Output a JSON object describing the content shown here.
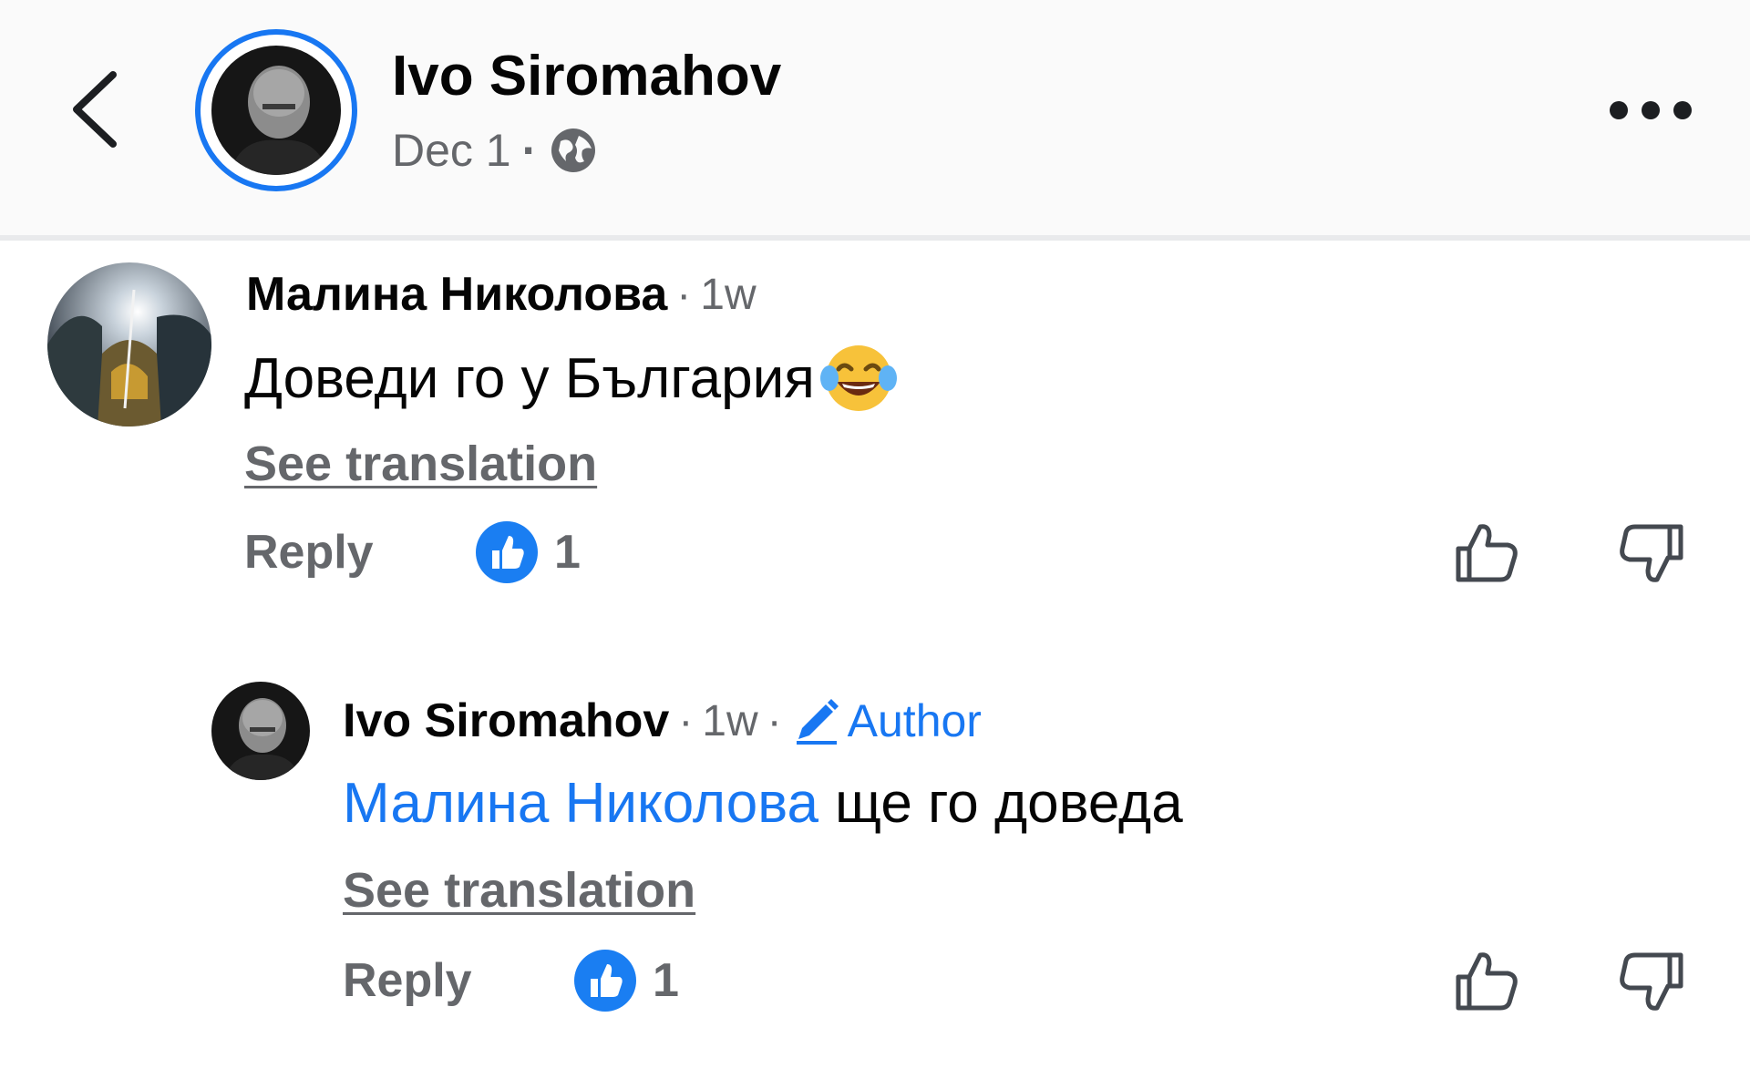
{
  "header": {
    "name": "Ivo Siromahov",
    "date": "Dec 1",
    "dot": "·",
    "icons": {
      "back": "chevron-left-icon",
      "privacy": "globe-icon",
      "more": "more-options-icon"
    }
  },
  "comments": [
    {
      "author": "Малина Николова",
      "time": "1w",
      "text": "Доведи го у България",
      "emoji": "😂",
      "see_translation": "See translation",
      "reply_label": "Reply",
      "like_count": "1"
    }
  ],
  "reply": {
    "author": "Ivo Siromahov",
    "time": "1w",
    "author_badge": "Author",
    "mention": "Малина Николова",
    "text": "ще го доведа",
    "see_translation": "See translation",
    "reply_label": "Reply",
    "like_count": "1"
  },
  "separators": {
    "dot": "·"
  },
  "colors": {
    "accent": "#1877f2",
    "secondary_text": "#65676b",
    "primary_text": "#050505"
  }
}
